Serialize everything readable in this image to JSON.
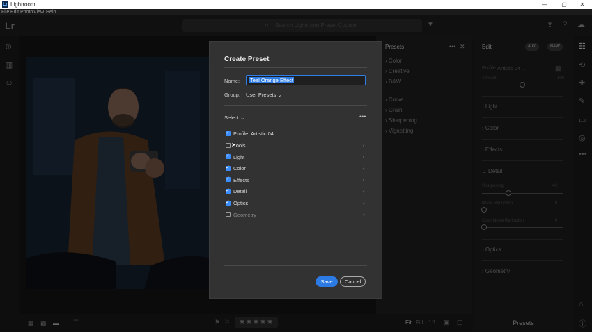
{
  "window": {
    "app_title": "Lightroom",
    "logo_text": "Lr",
    "menu": [
      "File",
      "Edit",
      "Photo",
      "View",
      "Help"
    ]
  },
  "toolbar": {
    "brand": "Lr",
    "search_placeholder": "Search Lightroom Preset Course"
  },
  "presets_panel": {
    "title": "Presets",
    "items": [
      "Color",
      "Creative",
      "B&W",
      "Curve",
      "Grain",
      "Sharpening",
      "Vignetting"
    ]
  },
  "edit_panel": {
    "title": "Edit",
    "auto_label": "Auto",
    "bw_label": "B&W",
    "profile_label": "Profile",
    "profile_value": "Artistic 04",
    "amount_label": "Amount",
    "amount_value": "100",
    "sections": [
      "Light",
      "Color",
      "Effects",
      "Detail",
      "Optics",
      "Geometry"
    ],
    "detail_sliders": [
      {
        "label": "Sharpening",
        "value": "40"
      },
      {
        "label": "Noise Reduction",
        "value": "0"
      },
      {
        "label": "Color Noise Reduction",
        "value": "0"
      }
    ],
    "footer": "Presets"
  },
  "bottom_bar": {
    "stars": "★★★★★",
    "fit": "Fit",
    "fill": "Fill",
    "one_to_one": "1:1"
  },
  "dialog": {
    "title": "Create Preset",
    "name_label": "Name:",
    "name_value": "Teal Orange Effect",
    "group_label": "Group:",
    "group_value": "User Presets",
    "select_label": "Select",
    "options": [
      {
        "label": "Profile: Artistic 04",
        "checked": true,
        "chevron": false
      },
      {
        "label": "Tools",
        "checked": false,
        "chevron": true
      },
      {
        "label": "Light",
        "checked": true,
        "chevron": true
      },
      {
        "label": "Color",
        "checked": true,
        "chevron": true
      },
      {
        "label": "Effects",
        "checked": true,
        "chevron": true
      },
      {
        "label": "Detail",
        "checked": true,
        "chevron": true
      },
      {
        "label": "Optics",
        "checked": true,
        "chevron": true
      },
      {
        "label": "Geometry",
        "checked": false,
        "chevron": true
      }
    ],
    "save_label": "Save",
    "cancel_label": "Cancel"
  },
  "colors": {
    "accent": "#2c7be5",
    "dialog_bg": "#323232",
    "app_bg": "#1b1b1b"
  }
}
